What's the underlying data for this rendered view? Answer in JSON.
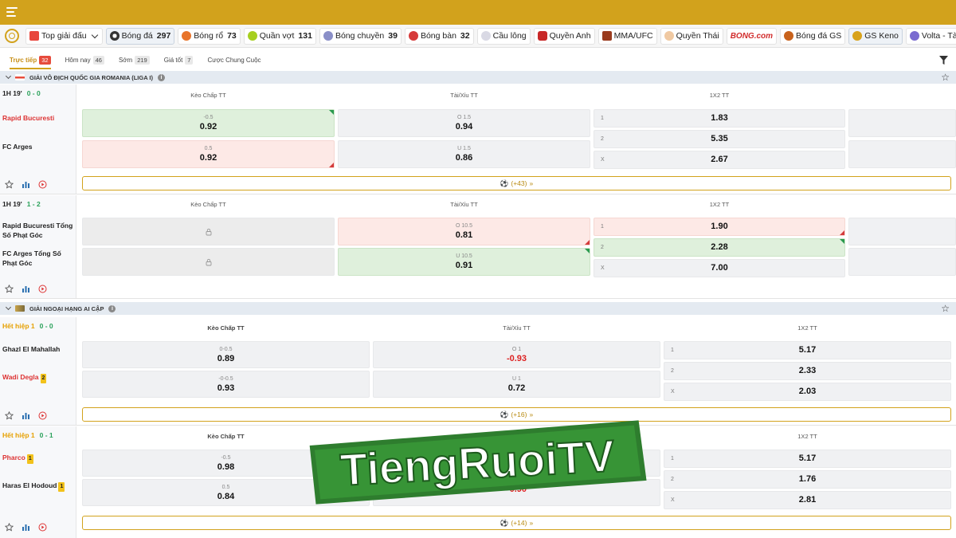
{
  "sports": [
    {
      "label": "Top giải đấu",
      "count": "",
      "icon_color": "#e8463c",
      "dropdown": true
    },
    {
      "label": "Bóng đá",
      "count": "297",
      "icon_color": "#333333",
      "active": true
    },
    {
      "label": "Bóng rổ",
      "count": "73",
      "icon_color": "#e8742a"
    },
    {
      "label": "Quần vợt",
      "count": "131",
      "icon_color": "#a6cf1f"
    },
    {
      "label": "Bóng chuyền",
      "count": "39",
      "icon_color": "#8a8fc8"
    },
    {
      "label": "Bóng bàn",
      "count": "32",
      "icon_color": "#d63a3a"
    },
    {
      "label": "Cầu lông",
      "count": "",
      "icon_color": "#b9b9c8"
    },
    {
      "label": "Quyền Anh",
      "count": "",
      "icon_color": "#c82727"
    },
    {
      "label": "MMA/UFC",
      "count": "",
      "icon_color": "#9a3b1e"
    },
    {
      "label": "Quyền Thái",
      "count": "",
      "icon_color": "#e8b07a"
    },
    {
      "label": "",
      "count": "",
      "icon_color": "#d12c2c",
      "brand": "BONG.com"
    },
    {
      "label": "Bóng đá GS",
      "count": "",
      "icon_color": "#c8621c"
    },
    {
      "label": "GS Keno",
      "count": "",
      "icon_color": "#d8a21a",
      "active": true
    },
    {
      "label": "Volta - Tài Xỉu Bó",
      "count": "",
      "icon_color": "#7a6bd0"
    }
  ],
  "filters": [
    {
      "label": "Trực tiếp",
      "count": "32",
      "active": true
    },
    {
      "label": "Hôm nay",
      "count": "46"
    },
    {
      "label": "Sớm",
      "count": "219"
    },
    {
      "label": "Giá tốt",
      "count": "7"
    },
    {
      "label": "Cược Chung Cuộc",
      "count": ""
    }
  ],
  "leagues": [
    {
      "name": "GIẢI VÔ ĐỊCH QUỐC GIA ROMANIA (LIGA I)",
      "info": "i",
      "matches": [
        {
          "time": "1H 19'",
          "score": "0 - 0",
          "headers": [
            "Kèo Chấp TT",
            "Tài/Xỉu TT",
            "1X2 TT"
          ],
          "teams": [
            "Rapid Bucuresti",
            "FC Arges"
          ],
          "handicap": [
            {
              "line": "-0.5",
              "odds": "0.92"
            },
            {
              "line": "0.5",
              "odds": "0.92"
            }
          ],
          "overunder": [
            {
              "line": "O 1.5",
              "odds": "0.94"
            },
            {
              "line": "U 1.5",
              "odds": "0.86"
            }
          ],
          "x12": [
            {
              "opt": "1",
              "odds": "1.83"
            },
            {
              "opt": "2",
              "odds": "5.35"
            },
            {
              "opt": "X",
              "odds": "2.67"
            }
          ],
          "more": "(+43)"
        },
        {
          "time": "1H 19'",
          "score": "1 - 2",
          "headers": [
            "Kèo Chấp TT",
            "Tài/Xỉu TT",
            "1X2 TT"
          ],
          "teams": [
            "Rapid Bucuresti Tổng Số Phạt Góc",
            "FC Arges Tổng Số Phạt Góc"
          ],
          "overunder": [
            {
              "line": "O 10.5",
              "odds": "0.81"
            },
            {
              "line": "U 10.5",
              "odds": "0.91"
            }
          ],
          "x12": [
            {
              "opt": "1",
              "odds": "1.90"
            },
            {
              "opt": "2",
              "odds": "2.28"
            },
            {
              "opt": "X",
              "odds": "7.00"
            }
          ]
        }
      ]
    },
    {
      "name": "GIẢI NGOẠI HẠNG AI CẬP",
      "info": "i",
      "matches": [
        {
          "time": "Hết hiệp 1",
          "score": "0 - 0",
          "headers": [
            "Kèo Chấp TT",
            "Tài/Xỉu TT",
            "1X2 TT"
          ],
          "teams": [
            "Ghazl El Mahallah",
            "Wadi Degla"
          ],
          "cards": [
            "",
            "2"
          ],
          "handicap": [
            {
              "line": "0-0.5",
              "odds": "0.89"
            },
            {
              "line": "-0-0.5",
              "odds": "0.93"
            }
          ],
          "overunder": [
            {
              "line": "O 1",
              "odds": "-0.93"
            },
            {
              "line": "U 1",
              "odds": "0.72"
            }
          ],
          "x12": [
            {
              "opt": "1",
              "odds": "5.17"
            },
            {
              "opt": "2",
              "odds": "2.33"
            },
            {
              "opt": "X",
              "odds": "2.03"
            }
          ],
          "more": "(+16)"
        },
        {
          "time": "Hết hiệp 1",
          "score": "0 - 1",
          "headers": [
            "Kèo Chấp TT",
            "Tài/Xỉu TT",
            "1X2 TT"
          ],
          "teams": [
            "Pharco",
            "Haras El Hodoud"
          ],
          "cards": [
            "1",
            "1"
          ],
          "handicap": [
            {
              "line": "-0.5",
              "odds": "0.98"
            },
            {
              "line": "0.5",
              "odds": "0.84"
            }
          ],
          "overunder": [
            {
              "line": "",
              "odds": ""
            },
            {
              "line": "",
              "odds": "-0.90"
            }
          ],
          "x12": [
            {
              "opt": "1",
              "odds": "5.17"
            },
            {
              "opt": "2",
              "odds": "1.76"
            },
            {
              "opt": "X",
              "odds": "2.81"
            }
          ],
          "more": "(+14)"
        }
      ]
    }
  ],
  "watermark": "TiengRuoiTV",
  "colors": {
    "brand": "#d2a21c",
    "green": "#2aa15a",
    "red": "#d33333"
  }
}
